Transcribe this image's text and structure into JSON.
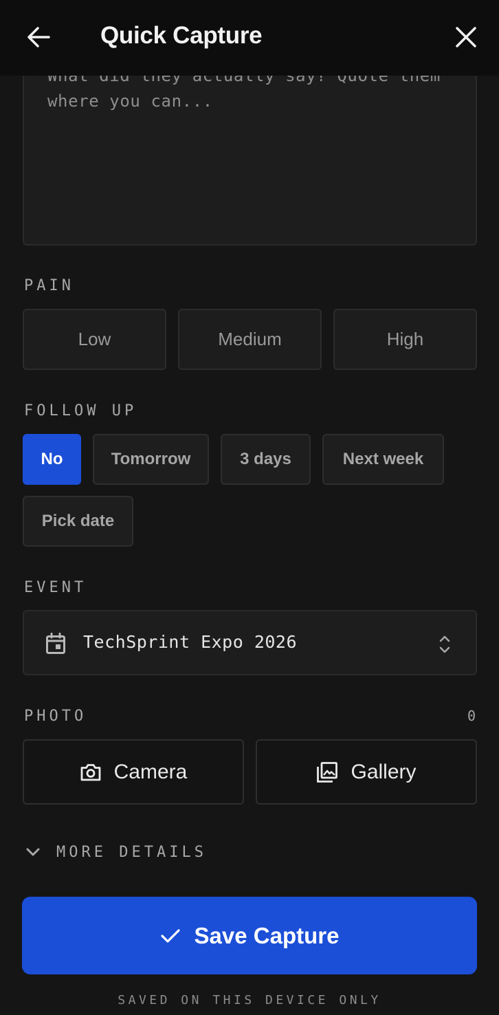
{
  "header": {
    "title": "Quick Capture",
    "back_icon": "arrow-left-icon",
    "close_icon": "close-icon"
  },
  "notes": {
    "placeholder": "What did they actually say? Quote them where you can...",
    "value": ""
  },
  "pain": {
    "label": "PAIN",
    "options": [
      "Low",
      "Medium",
      "High"
    ],
    "selected": null
  },
  "follow_up": {
    "label": "FOLLOW UP",
    "options": [
      "No",
      "Tomorrow",
      "3 days",
      "Next week",
      "Pick date"
    ],
    "selected": "No"
  },
  "event": {
    "label": "EVENT",
    "value": "TechSprint Expo 2026",
    "icon": "calendar-icon"
  },
  "photo": {
    "label": "PHOTO",
    "count": "0",
    "camera_label": "Camera",
    "gallery_label": "Gallery"
  },
  "more_details": {
    "label": "MORE DETAILS"
  },
  "save": {
    "label": "Save Capture"
  },
  "footer": {
    "note": "SAVED ON THIS DEVICE ONLY"
  },
  "colors": {
    "background": "#151515",
    "header": "#0d0d0d",
    "accent": "#1c4fd8",
    "field": "#1d1d1d",
    "border": "#2c2c2c"
  }
}
